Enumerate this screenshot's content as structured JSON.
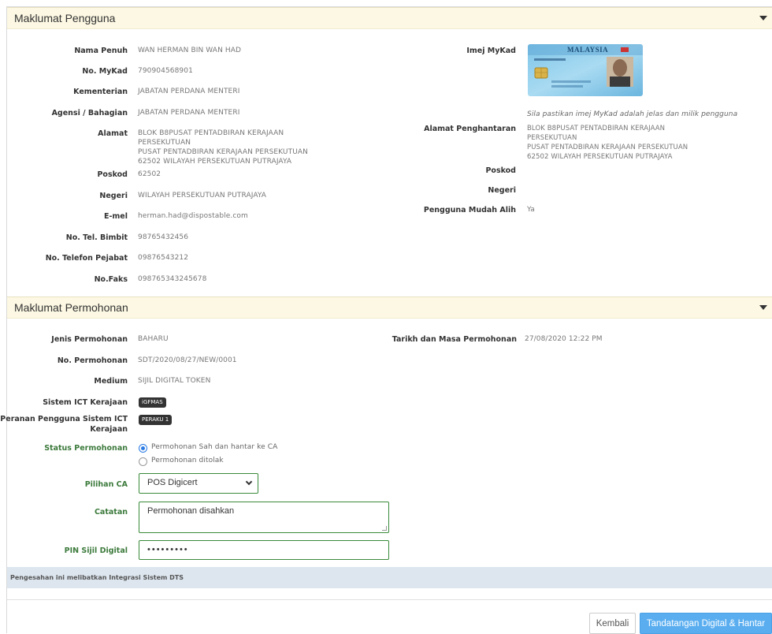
{
  "user_panel": {
    "title": "Maklumat Pengguna",
    "fields": [
      {
        "label": "Nama Penuh",
        "value": "WAN HERMAN BIN WAN HAD"
      },
      {
        "label": "No. MyKad",
        "value": "790904568901"
      },
      {
        "label": "Kementerian",
        "value": "JABATAN PERDANA MENTERI"
      },
      {
        "label": "Agensi / Bahagian",
        "value": "JABATAN PERDANA MENTERI"
      },
      {
        "label": "Alamat",
        "value": "BLOK B8PUSAT PENTADBIRAN KERAJAAN PERSEKUTUAN\nPUSAT PENTADBIRAN KERAJAAN PERSEKUTUAN\n62502 WILAYAH PERSEKUTUAN PUTRAJAYA"
      },
      {
        "label": "Poskod",
        "value": "62502"
      },
      {
        "label": "Negeri",
        "value": "WILAYAH PERSEKUTUAN PUTRAJAYA"
      },
      {
        "label": "E-mel",
        "value": "herman.had@dispostable.com"
      },
      {
        "label": "No. Tel. Bimbit",
        "value": "98765432456"
      },
      {
        "label": "No. Telefon Pejabat",
        "value": "09876543212"
      },
      {
        "label": "No.Faks",
        "value": "098765343245678"
      }
    ],
    "right": {
      "mykad_label": "Imej MyKad",
      "mykad_card_title": "MALAYSIA",
      "mykad_note": "Sila pastikan imej MyKad adalah jelas dan milik pengguna",
      "delivery_label": "Alamat Penghantaran",
      "delivery_value": "BLOK B8PUSAT PENTADBIRAN KERAJAAN PERSEKUTUAN\nPUSAT PENTADBIRAN KERAJAAN PERSEKUTUAN\n62502 WILAYAH PERSEKUTUAN PUTRAJAYA",
      "poskod_label": "Poskod",
      "poskod_value": "",
      "negeri_label": "Negeri",
      "negeri_value": "",
      "mobile_label": "Pengguna Mudah Alih",
      "mobile_value": "Ya"
    }
  },
  "application_panel": {
    "title": "Maklumat Permohonan",
    "jenis_label": "Jenis Permohonan",
    "jenis_value": "BAHARU",
    "tarikh_label": "Tarikh dan Masa Permohonan",
    "tarikh_value": "27/08/2020 12:22 PM",
    "nombor_label": "No. Permohonan",
    "nombor_value": "SDT/2020/08/27/NEW/0001",
    "medium_label": "Medium",
    "medium_value": "SIJIL DIGITAL TOKEN",
    "sistem_label": "Sistem ICT Kerajaan",
    "sistem_badge": "iGFMAS",
    "peranan_label_1": "Peranan Pengguna Sistem ICT",
    "peranan_label_2": "Kerajaan",
    "peranan_badge": "PERAKU 1",
    "status_label": "Status Permohonan",
    "status_options": [
      "Permohonan Sah dan hantar ke CA",
      "Permohonan ditolak"
    ],
    "status_selected": 0,
    "ca_label": "Pilihan CA",
    "ca_selected": "POS Digicert",
    "catatan_label": "Catatan",
    "catatan_value": "Permohonan disahkan",
    "pin_label": "PIN Sijil Digital",
    "pin_value": "•••••••••",
    "info_text": "Pengesahan ini melibatkan Integrasi Sistem DTS"
  },
  "actions": {
    "back_label": "Kembali",
    "sign_label": "Tandatangan Digital & Hantar"
  },
  "colors": {
    "panel_header_bg": "#fcf8e3",
    "accent_green": "#3c7a3c",
    "primary_button": "#5aaef0",
    "info_bar_bg": "#dde6ef"
  }
}
